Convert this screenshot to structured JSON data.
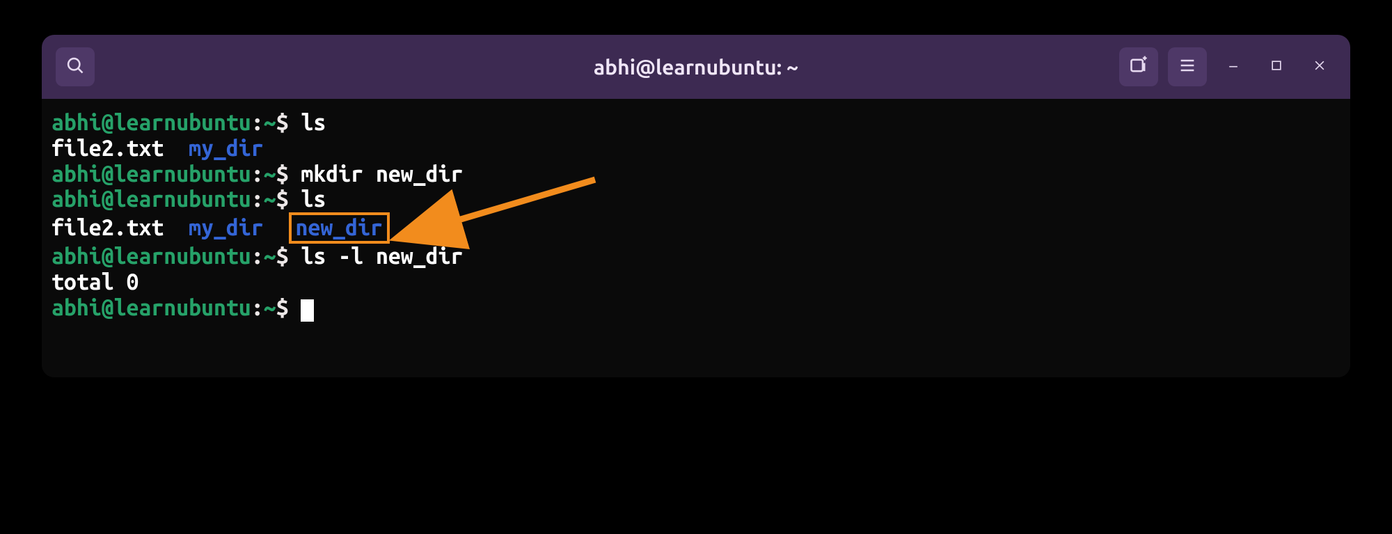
{
  "window": {
    "title": "abhi@learnubuntu: ~"
  },
  "prompt": {
    "user_host": "abhi@learnubuntu",
    "sep": ":",
    "path": "~",
    "symbol": "$"
  },
  "terminal": {
    "lines": [
      {
        "type": "cmd",
        "command": "ls"
      },
      {
        "type": "output_ls1",
        "file": "file2.txt",
        "dir1": "my_dir"
      },
      {
        "type": "cmd",
        "command": "mkdir new_dir"
      },
      {
        "type": "cmd",
        "command": "ls"
      },
      {
        "type": "output_ls2",
        "file": "file2.txt",
        "dir1": "my_dir",
        "dir2": "new_dir"
      },
      {
        "type": "cmd",
        "command": "ls -l new_dir"
      },
      {
        "type": "output_text",
        "text": "total 0"
      },
      {
        "type": "prompt_cursor"
      }
    ]
  },
  "colors": {
    "prompt_green": "#26a269",
    "dir_blue": "#3465d6",
    "highlight_orange": "#f28c1d",
    "titlebar_bg": "#3d2a52"
  }
}
